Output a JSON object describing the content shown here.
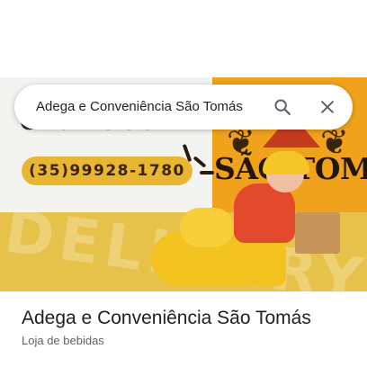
{
  "search": {
    "query": "Adega e Conveniência São Tomás"
  },
  "hero": {
    "phone": "(35)99928-1780",
    "brand_name": "SÃO TOMÁS",
    "partial_heading": "GES FOGO!",
    "watermark": "DELIVERY"
  },
  "place": {
    "title": "Adega e Conveniência São Tomás",
    "category": "Loja de bebidas"
  },
  "icons": [
    "search-icon",
    "close-icon"
  ],
  "colors": {
    "accent_yellow": "#e8b631",
    "orange_panel": "#f0a21c",
    "text_primary": "#202124",
    "text_secondary": "#5f6368",
    "icon_gray": "#5f6368"
  }
}
